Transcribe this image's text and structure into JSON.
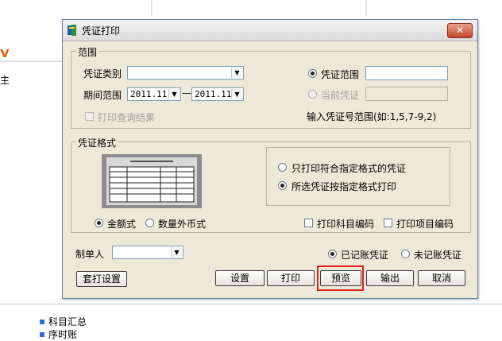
{
  "background": {
    "left_fragment": "v",
    "left_char": "主",
    "footer_items": [
      "科目汇总",
      "序时账"
    ]
  },
  "dialog": {
    "title": "凭证打印",
    "close_label": "✕",
    "range_group": {
      "legend": "范围",
      "voucher_type_label": "凭证类别",
      "voucher_type_value": "",
      "period_label": "期间范围",
      "period_from": "2011.11",
      "period_to": "2011.11",
      "period_dash": "—",
      "print_query_result": "打印查询结果",
      "voucher_range_label": "凭证范围",
      "voucher_range_value": "",
      "current_voucher_label": "当前凭证",
      "current_voucher_value": "",
      "hint": "输入凭证号范围(如:1,5,7-9,2)",
      "voucher_range_selected": true
    },
    "format_group": {
      "legend": "凭证格式",
      "amount_format": "金额式",
      "foreign_format": "数量外币式",
      "amount_selected": true,
      "only_matching": "只打印符合指定格式的凭证",
      "all_by_format": "所选凭证按指定格式打印",
      "all_by_format_selected": true,
      "print_subject_code": "打印科目编码",
      "print_item_code": "打印项目编码"
    },
    "creator_label": "制单人",
    "creator_value": "",
    "posted_voucher": "已记账凭证",
    "unposted_voucher": "未记账凭证",
    "posted_selected": true,
    "buttons": {
      "overprint_settings": "套打设置",
      "settings": "设置",
      "print": "打印",
      "preview": "预览",
      "export": "输出",
      "cancel": "取消"
    }
  },
  "colors": {
    "dialog_bg": "#ece9d8",
    "highlight": "#e02020",
    "close_button": "#c2452c"
  }
}
